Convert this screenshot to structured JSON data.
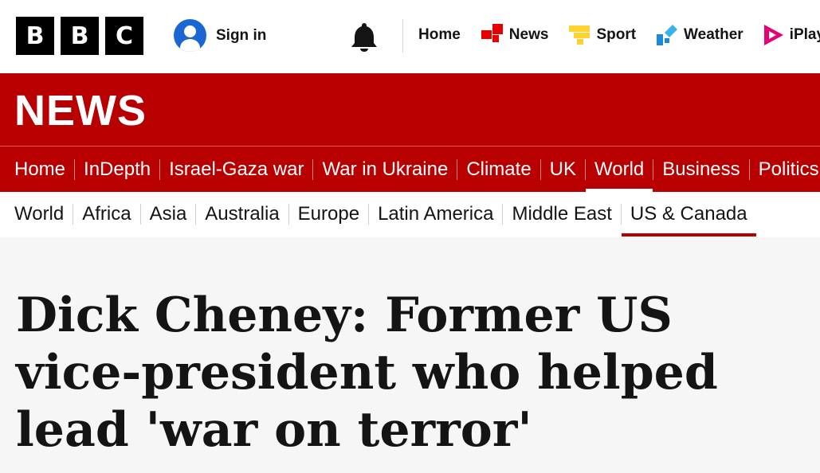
{
  "brand": {
    "letters": [
      "B",
      "B",
      "C"
    ]
  },
  "account": {
    "signin_label": "Sign in"
  },
  "topnav": [
    {
      "label": "Home",
      "icon": "none"
    },
    {
      "label": "News",
      "icon": "news-squares-icon",
      "color": "#e60000"
    },
    {
      "label": "Sport",
      "icon": "sport-bars-icon",
      "color": "#ffd230"
    },
    {
      "label": "Weather",
      "icon": "weather-icon",
      "color": "#1a8ad9"
    },
    {
      "label": "iPlayer",
      "icon": "iplayer-icon",
      "color": "#e60073"
    }
  ],
  "banner": {
    "title": "NEWS"
  },
  "section_nav": [
    {
      "label": "Home",
      "active": false
    },
    {
      "label": "InDepth",
      "active": false
    },
    {
      "label": "Israel-Gaza war",
      "active": false
    },
    {
      "label": "War in Ukraine",
      "active": false
    },
    {
      "label": "Climate",
      "active": false
    },
    {
      "label": "UK",
      "active": false
    },
    {
      "label": "World",
      "active": true
    },
    {
      "label": "Business",
      "active": false
    },
    {
      "label": "Politics",
      "active": false
    }
  ],
  "sub_nav": [
    {
      "label": "World",
      "active": false
    },
    {
      "label": "Africa",
      "active": false
    },
    {
      "label": "Asia",
      "active": false
    },
    {
      "label": "Australia",
      "active": false
    },
    {
      "label": "Europe",
      "active": false
    },
    {
      "label": "Latin America",
      "active": false
    },
    {
      "label": "Middle East",
      "active": false
    },
    {
      "label": "US & Canada",
      "active": true
    }
  ],
  "article": {
    "headline": "Dick Cheney: Former US vice-president who helped lead 'war on terror'"
  },
  "colors": {
    "brand_red": "#b80000",
    "account_blue": "#1a66d3"
  }
}
